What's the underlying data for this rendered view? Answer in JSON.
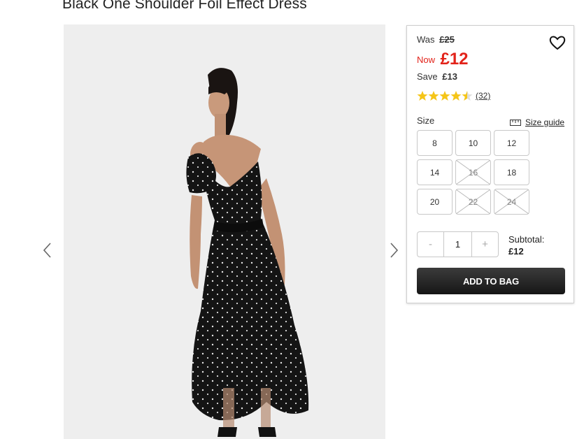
{
  "product": {
    "title": "Black One Shoulder Foil Effect Dress",
    "image_alt": "Model wearing black one shoulder polka dot maxi dress"
  },
  "gallery": {
    "prev_icon": "chevron-left-icon",
    "next_icon": "chevron-right-icon"
  },
  "price": {
    "was_label": "Was",
    "was_value": "£25",
    "now_label": "Now",
    "now_value": "£12",
    "save_label": "Save",
    "save_value": "£13",
    "now_color": "#e2231a"
  },
  "wishlist": {
    "icon": "heart-icon"
  },
  "rating": {
    "stars": 4.5,
    "max": 5,
    "count_text": "(32)",
    "star_color": "#f5c518"
  },
  "size": {
    "label": "Size",
    "guide_label": "Size guide",
    "guide_icon": "ruler-icon",
    "options": [
      {
        "label": "8",
        "available": true
      },
      {
        "label": "10",
        "available": true
      },
      {
        "label": "12",
        "available": true
      },
      {
        "label": "14",
        "available": true
      },
      {
        "label": "16",
        "available": false
      },
      {
        "label": "18",
        "available": true
      },
      {
        "label": "20",
        "available": true
      },
      {
        "label": "22",
        "available": false
      },
      {
        "label": "24",
        "available": false
      }
    ]
  },
  "quantity": {
    "minus_label": "-",
    "value": "1",
    "plus_label": "+"
  },
  "subtotal": {
    "label": "Subtotal:",
    "value": "£12"
  },
  "cart": {
    "add_label": "ADD TO BAG",
    "button_color": "#1e1e1e"
  }
}
